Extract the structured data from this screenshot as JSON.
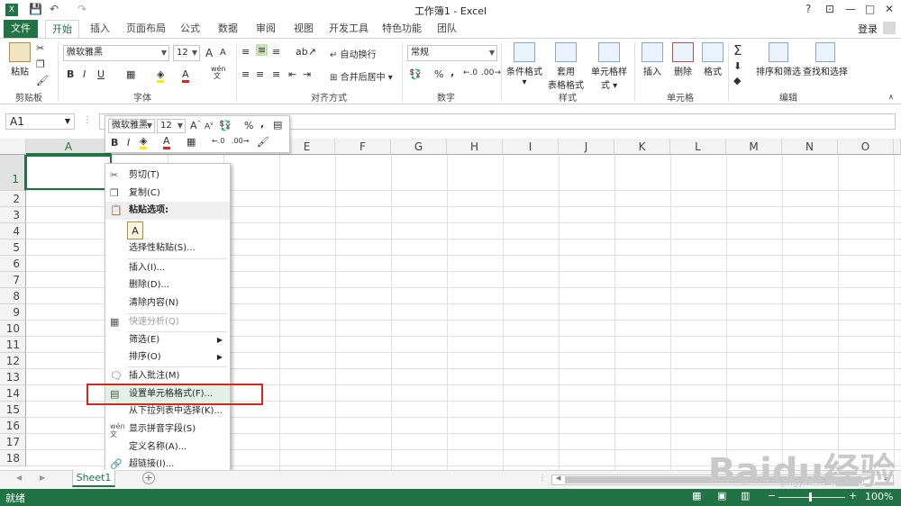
{
  "window": {
    "title": "工作簿1 - Excel",
    "help": "?",
    "minimize": "—",
    "maximize": "□",
    "close": "✕",
    "ribbon_display": "⊡"
  },
  "quick_access": {
    "save_icon": "💾",
    "undo_icon": "↶",
    "redo_icon": "↷"
  },
  "tabs": [
    "文件",
    "开始",
    "插入",
    "页面布局",
    "公式",
    "数据",
    "审阅",
    "视图",
    "开发工具",
    "特色功能",
    "团队"
  ],
  "login": "登录",
  "ribbon": {
    "clipboard": {
      "paste": "粘贴",
      "label": "剪贴板"
    },
    "font": {
      "name": "微软雅黑",
      "size": "12",
      "bold": "B",
      "italic": "I",
      "underline": "U",
      "grow": "A",
      "shrink": "A",
      "label": "字体",
      "wen": "wén 文"
    },
    "alignment": {
      "wrap": "自动换行",
      "merge": "合并后居中",
      "label": "对齐方式"
    },
    "number": {
      "format": "常规",
      "percent": "%",
      "comma": ",",
      "label": "数字"
    },
    "styles": {
      "conditional": "条件格式",
      "table1": "套用",
      "table2": "表格格式",
      "cell_styles": "单元格样式",
      "label": "样式"
    },
    "cells": {
      "insert": "插入",
      "delete": "删除",
      "format": "格式",
      "label": "单元格"
    },
    "editing": {
      "sigma": "Σ",
      "sort": "排序和筛选",
      "find": "查找和选择",
      "label": "编辑"
    }
  },
  "formula_bar": {
    "name_box": "A1",
    "value": ""
  },
  "mini_toolbar": {
    "font": "微软雅黑",
    "size": "12",
    "bold": "B",
    "italic": "I",
    "percent": "%",
    "comma": ","
  },
  "columns": [
    "A",
    "D",
    "E",
    "F",
    "G",
    "H",
    "I",
    "J",
    "K",
    "L",
    "M",
    "N",
    "O"
  ],
  "rows": [
    "1",
    "2",
    "3",
    "4",
    "5",
    "6",
    "7",
    "8",
    "9",
    "10",
    "11",
    "12",
    "13",
    "14",
    "15",
    "16",
    "17",
    "18"
  ],
  "context_menu": {
    "cut": "剪切(T)",
    "copy": "复制(C)",
    "paste_options": "粘贴选项:",
    "paste_glyph": "A",
    "paste_special": "选择性粘贴(S)...",
    "insert": "插入(I)...",
    "delete": "删除(D)...",
    "clear": "清除内容(N)",
    "quick_analysis": "快速分析(Q)",
    "filter": "筛选(E)",
    "sort": "排序(O)",
    "insert_comment": "插入批注(M)",
    "format_cells": "设置单元格格式(F)...",
    "pick_list": "从下拉列表中选择(K)...",
    "phonetic": "显示拼音字段(S)",
    "define_name": "定义名称(A)...",
    "hyperlink": "超链接(I)..."
  },
  "sheet_tabs": [
    "Sheet1"
  ],
  "status": {
    "ready": "就绪",
    "zoom": "100%",
    "minus": "−",
    "plus": "+"
  },
  "watermark": {
    "brand": "Baidu经验",
    "url": "jingyan.baidu.com"
  },
  "colors": {
    "accent": "#217346",
    "highlight_box": "#d9251c"
  }
}
